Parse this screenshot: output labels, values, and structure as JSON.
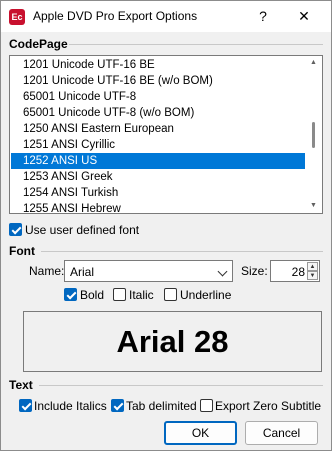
{
  "window": {
    "title": "Apple DVD Pro Export Options",
    "app_icon_text": "Ec",
    "help_glyph": "?",
    "close_glyph": "✕"
  },
  "codepage": {
    "section_label": "CodePage",
    "items": [
      "1201 Unicode UTF-16 BE",
      "1201 Unicode UTF-16 BE (w/o BOM)",
      "65001 Unicode UTF-8",
      "65001 Unicode UTF-8 (w/o BOM)",
      "1250 ANSI Eastern European",
      "1251 ANSI Cyrillic",
      "1252 ANSI US",
      "1253 ANSI Greek",
      "1254 ANSI Turkish",
      "1255 ANSI Hebrew"
    ],
    "selected": "1252 ANSI US",
    "use_user_font": {
      "label": "Use user defined font",
      "checked": true
    }
  },
  "font": {
    "section_label": "Font",
    "name_label": "Name:",
    "name_value": "Arial",
    "size_label": "Size:",
    "size_value": "28",
    "bold": {
      "label": "Bold",
      "checked": true
    },
    "italic": {
      "label": "Italic",
      "checked": false
    },
    "underline": {
      "label": "Underline",
      "checked": false
    },
    "preview_text": "Arial  28"
  },
  "text": {
    "section_label": "Text",
    "include_italics": {
      "label": "Include Italics",
      "checked": true
    },
    "tab_delimited": {
      "label": "Tab delimited",
      "checked": true
    },
    "export_zero_subtitle": {
      "label": "Export Zero Subtitle",
      "checked": false
    }
  },
  "buttons": {
    "ok": "OK",
    "cancel": "Cancel"
  },
  "colors": {
    "accent": "#0078d7",
    "checkbox_fill": "#0067c0",
    "app_icon": "#c8102e"
  }
}
